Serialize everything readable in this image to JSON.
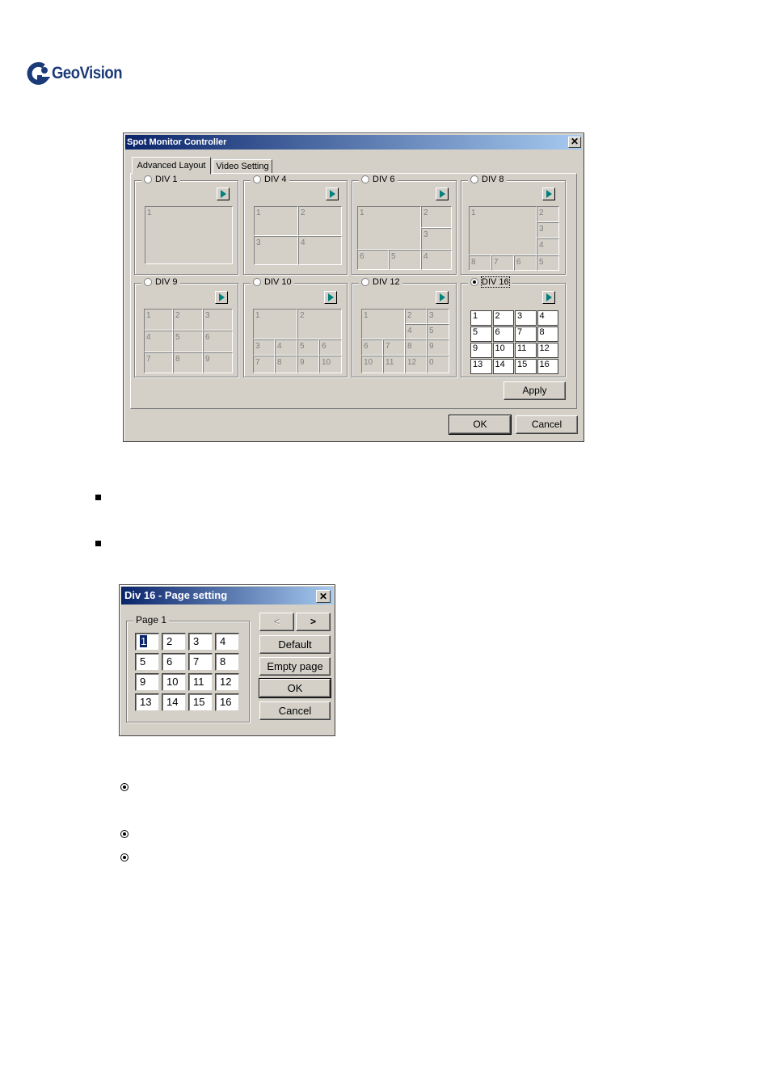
{
  "brand": {
    "name": "GeoVision"
  },
  "spot": {
    "title": "Spot Monitor Controller",
    "tabs": [
      "Advanced Layout",
      "Video Setting"
    ],
    "groups": [
      {
        "label": "DIV 1",
        "cells": [
          "1"
        ]
      },
      {
        "label": "DIV 4",
        "cells": [
          "1",
          "2",
          "3",
          "4"
        ]
      },
      {
        "label": "DIV 6",
        "cells": [
          "1",
          "2",
          "3",
          "4",
          "5",
          "6"
        ]
      },
      {
        "label": "DIV 8",
        "cells": [
          "1",
          "2",
          "3",
          "4",
          "5",
          "6",
          "7",
          "8"
        ]
      },
      {
        "label": "DIV 9",
        "cells": [
          "1",
          "2",
          "3",
          "4",
          "5",
          "6",
          "7",
          "8",
          "9"
        ]
      },
      {
        "label": "DIV 10",
        "cells": [
          "1",
          "2",
          "3",
          "4",
          "5",
          "6",
          "7",
          "8",
          "9",
          "10"
        ]
      },
      {
        "label": "DIV 12",
        "cells": [
          "1",
          "2",
          "3",
          "4",
          "5",
          "6",
          "7",
          "8",
          "9",
          "10",
          "11",
          "12",
          "0"
        ]
      },
      {
        "label": "DIV 16",
        "selected": true,
        "cells": [
          "1",
          "2",
          "3",
          "4",
          "5",
          "6",
          "7",
          "8",
          "9",
          "10",
          "11",
          "12",
          "13",
          "14",
          "15",
          "16"
        ]
      }
    ],
    "apply_label": "Apply",
    "ok_label": "OK",
    "cancel_label": "Cancel"
  },
  "page_setting": {
    "title": "Div 16 - Page setting",
    "group_label": "Page 1",
    "cells": [
      "1",
      "2",
      "3",
      "4",
      "5",
      "6",
      "7",
      "8",
      "9",
      "10",
      "11",
      "12",
      "13",
      "14",
      "15",
      "16"
    ],
    "prev_label": "<",
    "next_label": ">",
    "default_label": "Default",
    "empty_label": "Empty page",
    "ok_label": "OK",
    "cancel_label": "Cancel"
  }
}
